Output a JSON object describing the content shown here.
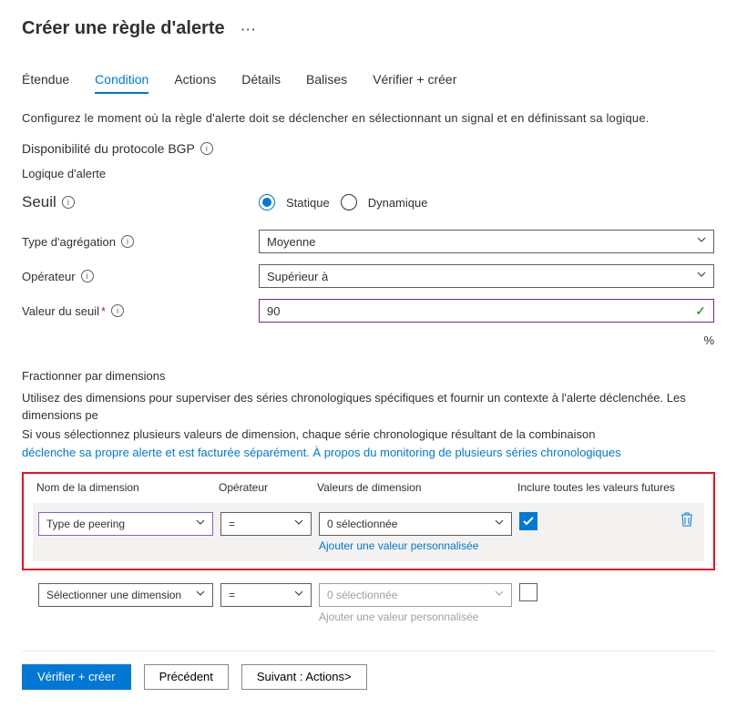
{
  "page_title": "Créer une règle d'alerte",
  "tabs": {
    "etendue": "Étendue",
    "condition": "Condition",
    "actions": "Actions",
    "details": "Détails",
    "balises": "Balises",
    "verifier": "Vérifier + créer"
  },
  "intro_text": "Configurez le moment où la règle d'alerte doit se déclencher en sélectionnant un signal et en définissant sa logique.",
  "signal_title": "Disponibilité du protocole BGP",
  "logic_label": "Logique d'alerte",
  "threshold": {
    "label": "Seuil",
    "static": "Statique",
    "dynamic": "Dynamique",
    "selected": "static"
  },
  "fields": {
    "aggregation_label": "Type d'agrégation",
    "aggregation_value": "Moyenne",
    "operator_label": "Opérateur",
    "operator_value": "Supérieur à",
    "threshold_label": "Valeur du seuil",
    "threshold_value": "90",
    "threshold_unit": "%"
  },
  "dimensions": {
    "heading": "Fractionner par dimensions",
    "desc1": "Utilisez des dimensions pour superviser des séries chronologiques spécifiques et fournir un contexte à l'alerte déclenchée. Les dimensions pe",
    "desc2": "Si vous sélectionnez plusieurs valeurs de dimension, chaque série chronologique résultant de la combinaison",
    "link_text": "déclenche sa propre alerte et est facturée séparément. À propos du monitoring de plusieurs séries chronologiques",
    "col_name": "Nom de la dimension",
    "col_operator": "Opérateur",
    "col_values": "Valeurs de dimension",
    "col_future": "Inclure toutes les valeurs futures",
    "row1": {
      "name": "Type de peering",
      "operator": "=",
      "values": "0 sélectionnée",
      "future_checked": true,
      "custom_link": "Ajouter une valeur personnalisée"
    },
    "row2": {
      "name": "Sélectionner une dimension",
      "operator": "=",
      "values": "0 sélectionnée",
      "future_checked": false,
      "custom_link": "Ajouter une valeur personnalisée"
    }
  },
  "footer": {
    "primary": "Vérifier + créer",
    "prev": "Précédent",
    "next": "Suivant : Actions>"
  }
}
